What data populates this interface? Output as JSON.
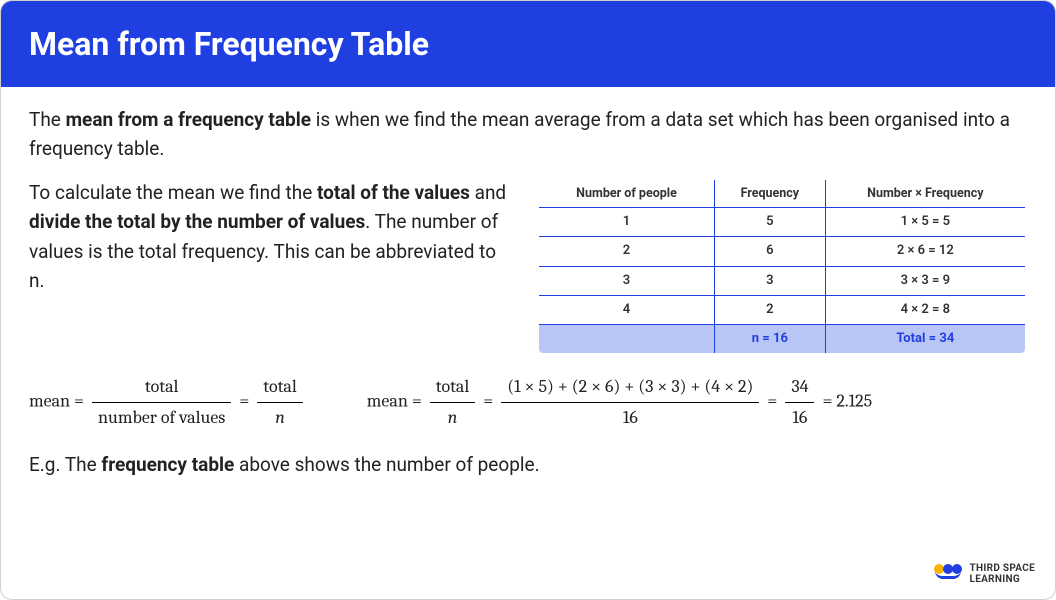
{
  "header": {
    "title": "Mean from Frequency Table"
  },
  "intro": {
    "pre": "The ",
    "bold1": "mean from a frequency table",
    "post": " is when we find the mean average from a data set which has been organised into a frequency table."
  },
  "para": {
    "p1": "To calculate the mean we find the ",
    "b1": "total of the values",
    "p2": " and ",
    "b2": "divide the total by the number of values",
    "p3": ". The number of values is the total frequency.  This can be abbreviated to n."
  },
  "table": {
    "headers": [
      "Number of people",
      "Frequency",
      "Number × Frequency"
    ],
    "rows": [
      [
        "1",
        "5",
        "1 × 5 = 5"
      ],
      [
        "2",
        "6",
        "2 × 6 = 12"
      ],
      [
        "3",
        "3",
        "3 × 3 = 9"
      ],
      [
        "4",
        "2",
        "4 × 2 = 8"
      ]
    ],
    "totals": [
      "",
      "n = 16",
      "Total = 34"
    ]
  },
  "formula1": {
    "lead": "mean = ",
    "num1": "total",
    "den1": "number of values",
    "eq": " = ",
    "num2": "total",
    "den2": "n"
  },
  "formula2": {
    "lead": "mean = ",
    "num1": "total",
    "den1": "n",
    "eq1": " = ",
    "num2": "(1 × 5) + (2 × 6) + (3 × 3) + (4 × 2)",
    "den2": "16",
    "eq2": " = ",
    "num3": "34",
    "den3": "16",
    "eq3": " = 2.125"
  },
  "eg": {
    "pre": "E.g. The ",
    "bold": "frequency table",
    "post": " above shows the number of people."
  },
  "logo": {
    "line1": "THIRD SPACE",
    "line2": "LEARNING"
  }
}
